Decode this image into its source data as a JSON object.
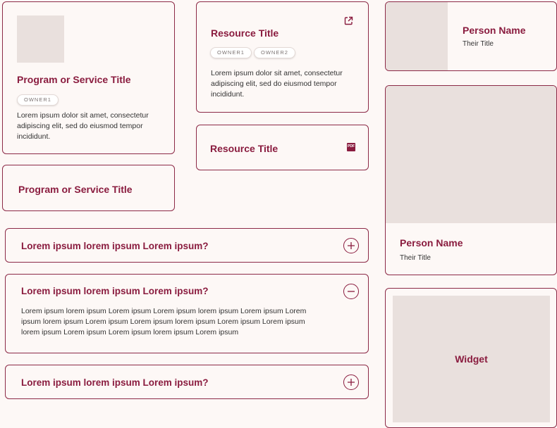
{
  "program_card": {
    "title": "Program or Service Title",
    "owners": [
      "OWNER1"
    ],
    "description": "Lorem ipsum dolor sit amet, consectetur adipiscing elit, sed do eiusmod tempor incididunt."
  },
  "program_card_compact": {
    "title": "Program or Service Title"
  },
  "resource_card": {
    "title": "Resource Title",
    "owners": [
      "OWNER1",
      "OWNER2"
    ],
    "description": "Lorem ipsum dolor sit amet, consectetur adipiscing elit, sed do eiusmod tempor incididunt.",
    "icon": "external-link-icon"
  },
  "resource_card_pdf": {
    "title": "Resource Title",
    "icon": "pdf-icon",
    "icon_text": "PDF"
  },
  "accordion": [
    {
      "question": "Lorem ipsum lorem ipsum Lorem ipsum?",
      "expanded": false,
      "toggle": "+",
      "icon": "plus-circle-icon"
    },
    {
      "question": "Lorem ipsum lorem ipsum Lorem ipsum?",
      "expanded": true,
      "toggle": "−",
      "icon": "minus-circle-icon",
      "answer": "Lorem ipsum lorem ipsum Lorem ipsum Lorem ipsum lorem ipsum Lorem ipsum Lorem ipsum lorem ipsum Lorem ipsum Lorem ipsum lorem ipsum Lorem ipsum Lorem ipsum lorem ipsum Lorem ipsum Lorem ipsum lorem ipsum Lorem ipsum"
    },
    {
      "question": "Lorem ipsum lorem ipsum Lorem ipsum?",
      "expanded": false,
      "toggle": "+",
      "icon": "plus-circle-icon"
    }
  ],
  "person_card_horizontal": {
    "name": "Person Name",
    "title": "Their Title"
  },
  "person_card_vertical": {
    "name": "Person Name",
    "title": "Their Title"
  },
  "widget": {
    "label": "Widget"
  },
  "colors": {
    "accent": "#8a1c3f",
    "border": "#8c2a47",
    "background": "#fdf8f6",
    "placeholder": "#e9e0dd"
  }
}
